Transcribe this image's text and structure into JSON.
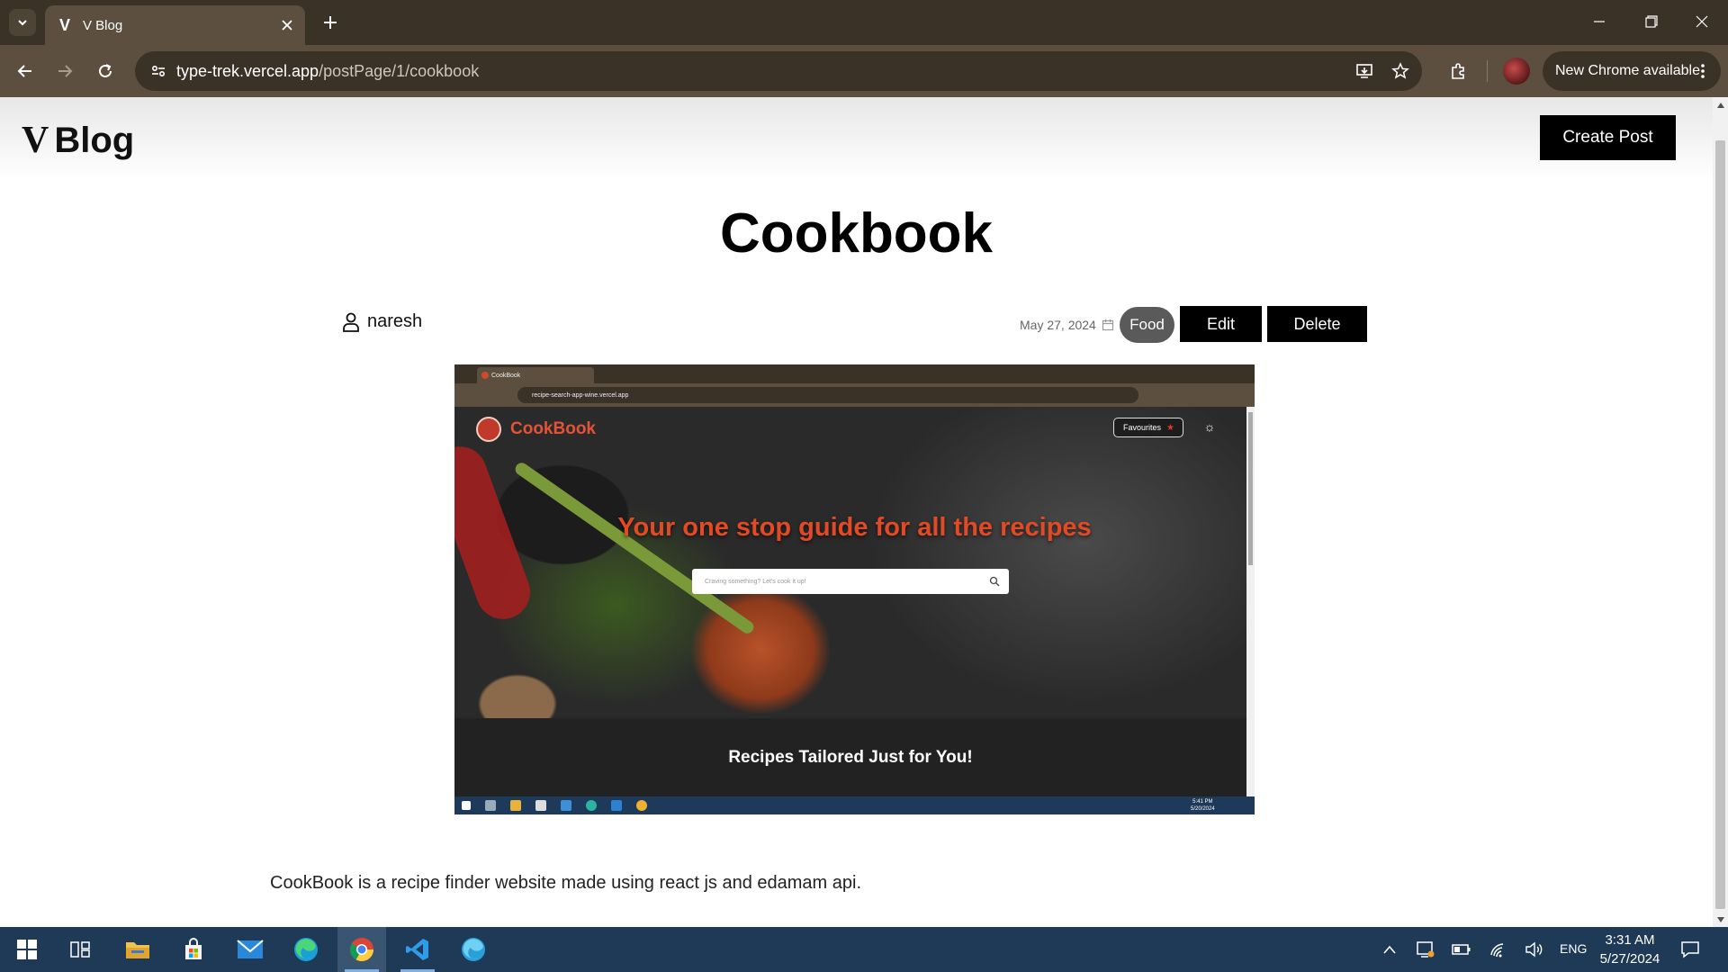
{
  "browser": {
    "tab_title": "V Blog",
    "url_host": "type-trek.vercel.app",
    "url_path": "/postPage/1/cookbook",
    "update_label": "New Chrome available",
    "icons": [
      "tab-search-icon",
      "close-icon",
      "plus-icon",
      "minimize-icon",
      "restore-icon",
      "back-icon",
      "forward-icon",
      "reload-icon",
      "site-info-icon",
      "install-icon",
      "star-icon",
      "extensions-icon",
      "kebab-icon"
    ]
  },
  "site": {
    "logo_mark": "V",
    "logo_text": "Blog",
    "create_post_label": "Create Post"
  },
  "post": {
    "title": "Cookbook",
    "author": "naresh",
    "date": "May 27, 2024",
    "category": "Food",
    "edit_label": "Edit",
    "delete_label": "Delete",
    "body": "CookBook is a recipe finder website made using react js and edamam api."
  },
  "screenshot": {
    "tab_title": "CookBook",
    "url": "recipe-search-app-wine.vercel.app",
    "brand": "CookBook",
    "favourites_label": "Favourites",
    "tagline": "Your one stop guide for all the recipes",
    "search_placeholder": "Craving something? Let's cook it up!",
    "section_title": "Recipes Tailored Just for You!",
    "clock_time": "5:41 PM",
    "clock_date": "5/20/2024",
    "accent_color": "#e14a24"
  },
  "taskbar": {
    "apps": [
      "windows-start-icon",
      "task-view-icon",
      "file-explorer-icon",
      "microsoft-store-icon",
      "mail-icon",
      "edge-icon",
      "chrome-icon",
      "vscode-icon",
      "edge-beta-icon"
    ],
    "lang": "ENG",
    "time": "3:31 AM",
    "date": "5/27/2024"
  }
}
